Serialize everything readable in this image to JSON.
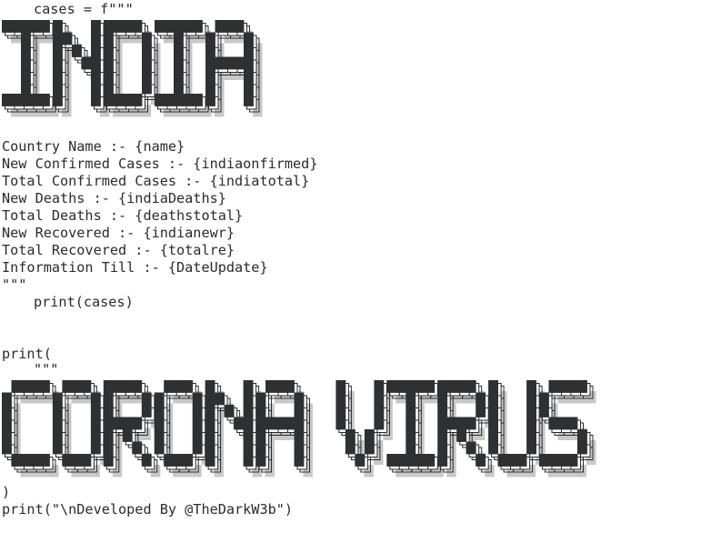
{
  "editor": {
    "lines": [
      {
        "text": "cases = f\"\"\"",
        "indent": true
      },
      {
        "text": "Country Name :- {name}",
        "indent": false
      },
      {
        "text": "New Confirmed Cases :- {indiaonfirmed}",
        "indent": false
      },
      {
        "text": "Total Confirmed Cases :- {indiatotal}",
        "indent": false
      },
      {
        "text": "New Deaths :- {indiaDeaths}",
        "indent": false
      },
      {
        "text": "Total Deaths :- {deathstotal}",
        "indent": false
      },
      {
        "text": "New Recovered :- {indianewr}",
        "indent": false
      },
      {
        "text": "Total Recovered :- {totalre}",
        "indent": false
      },
      {
        "text": "Information Till :- {DateUpdate}",
        "indent": false
      },
      {
        "text": "\"\"\"",
        "indent": false
      },
      {
        "text": "print(cases)",
        "indent": true
      },
      {
        "text": "print(",
        "indent": false
      },
      {
        "text": "\"\"\"",
        "indent": true
      },
      {
        "text": ")",
        "indent": false
      },
      {
        "text": "print(\"\\nDeveloped By @TheDarkW3b\")",
        "indent": false
      }
    ],
    "banners": [
      {
        "text": "INDIA"
      },
      {
        "text": "CORONA VIRUS"
      }
    ],
    "colors": {
      "text": "#2b2b2b",
      "block_fill": "#2e3032",
      "shadow_fill": "#c8c8c8",
      "outline": "#2b2b2b",
      "background": "#ffffff"
    }
  }
}
